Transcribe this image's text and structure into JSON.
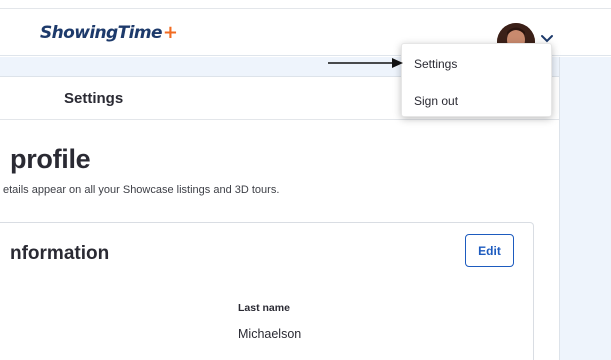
{
  "header": {
    "logo_text": "ShowingTime",
    "logo_plus": "+",
    "brand_color": "#1d3a6b",
    "plus_color": "#f26b21"
  },
  "menu": {
    "settings_label": "Settings",
    "signout_label": "Sign out"
  },
  "tab": {
    "label": "Settings"
  },
  "profile": {
    "title": "profile",
    "subtitle": "etails appear on all your Showcase listings and 3D tours."
  },
  "info": {
    "title": "nformation",
    "edit_label": "Edit",
    "last_name_label": "Last name",
    "last_name_value": "Michaelson"
  },
  "icons": [
    "chevron-down-icon",
    "avatar",
    "arrow-icon"
  ],
  "accent_color": "#1d5bbf"
}
